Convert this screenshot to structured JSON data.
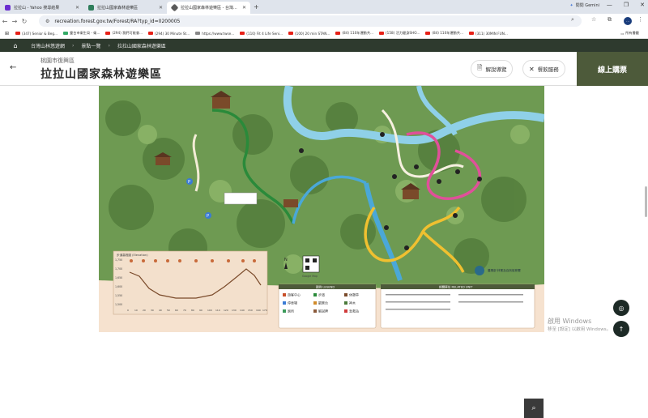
{
  "browser": {
    "tabs": [
      {
        "label": "拉拉山 - Yahoo 搜尋結果",
        "color": "#6b2fd0"
      },
      {
        "label": "拉拉山國家森林遊樂區",
        "color": "#2e7d5b"
      },
      {
        "label": "拉拉山國家森林遊樂區 - 台灣...",
        "color": "#5a5a5a"
      }
    ],
    "gemini_label": "問問 Gemini",
    "url": "recreation.forest.gov.tw/Forest/RA?typ_id=0200005",
    "bookmarks": [
      "(347) Senior & Beg...",
      "靈台市衛生局 - 衛...",
      "(294) 我們可能會...",
      "(294) 30 Minute St...",
      "https://www.twse...",
      "(110) Fit 4 Life Seni...",
      "(100) 20 min STAN...",
      "(84) 110年運動共...",
      "(158) 活力健身SHO...",
      "(84) 110年運動共...",
      "(311) 30MIN FUN..."
    ],
    "all_bookmarks": "所有書籤"
  },
  "breadcrumb": {
    "items": [
      "台灣山林悠遊網",
      "景點一覽",
      "拉拉山國家森林遊樂區"
    ]
  },
  "header": {
    "region": "桃園市復興區",
    "title": "拉拉山國家森林遊樂區",
    "audio_guide": "解說導覽",
    "dining": "餐飲服務",
    "buy": "線上購票"
  },
  "map": {
    "profile_title": "步道高程圖 (Elevation)",
    "elevation_ticks": [
      "1,750",
      "1,700",
      "1,650",
      "1,600",
      "1,550",
      "1,500"
    ],
    "distance_ticks": [
      "0",
      "10",
      "20",
      "30",
      "40",
      "50",
      "60",
      "70",
      "80",
      "90",
      "100",
      "110",
      "120",
      "130",
      "140",
      "150",
      "160",
      "170"
    ],
    "legend_title": "圖例 LEGEND",
    "legend_items": [
      "遊客中心",
      "停車場",
      "廁所",
      "步道",
      "觀景台",
      "解說牌",
      "休憩亭",
      "神木",
      "急救站"
    ],
    "related_title": "相關單位 RELATED UNIT",
    "qr_caption": "Google Map",
    "north": "N",
    "agency": "農業部 林業及自然保育署"
  },
  "watermark": {
    "line1": "啟用 Windows",
    "line2": "移至 [設定] 以啟用 Windows。"
  },
  "colors": {
    "green_trail": "#2a8a3a",
    "blue_trail": "#4aa8d8",
    "pink_trail": "#e0509a",
    "yellow_trail": "#f0c030",
    "header_dark": "#2e3a2e",
    "buy_bg": "#4d5a3a"
  }
}
